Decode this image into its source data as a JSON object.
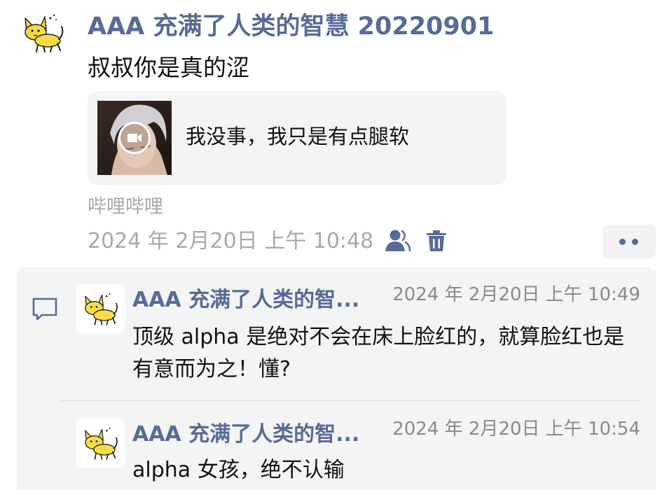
{
  "post": {
    "author": "AAA 充满了人类的智慧 20220901",
    "text": "叔叔你是真的涩",
    "share": {
      "title": "我没事，我只是有点腿软",
      "kind": "video"
    },
    "source": "哔哩哔哩",
    "timestamp": "2024 年 2月20日 上午 10:48"
  },
  "comments": [
    {
      "author": "AAA 充满了人类的智...",
      "time": "2024 年 2月20日 上午 10:49",
      "text": "顶级 alpha 是绝对不会在床上脸红的，就算脸红也是有意而为之！懂?"
    },
    {
      "author": "AAA 充满了人类的智...",
      "time": "2024 年 2月20日 上午 10:54",
      "text": "alpha 女孩，绝不认输"
    }
  ],
  "colors": {
    "name_link": "#576b95",
    "meta_gray": "#a9a9ad",
    "card_bg": "#f4f4f5",
    "avatar_cat": "#f7dc45"
  },
  "icons": [
    "cat-avatar-icon",
    "video-play-icon",
    "visibility-icon",
    "delete-icon",
    "more-dots-icon",
    "comment-icon"
  ]
}
